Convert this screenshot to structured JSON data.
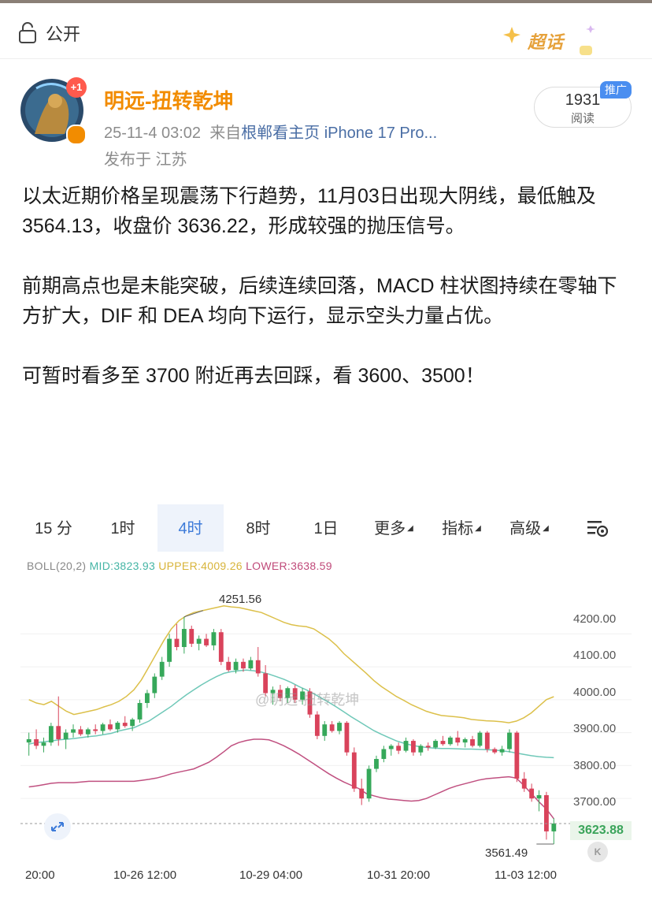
{
  "visibility": {
    "label": "公开",
    "icon": "lock-icon"
  },
  "topic_badge": {
    "label": "超话"
  },
  "author": {
    "name": "明远-扭转乾坤",
    "badge": "+1",
    "timestamp": "25-11-4 03:02",
    "source_prefix": "来自",
    "source": "根郸看主页 iPhone 17 Pro...",
    "location": "发布于 江苏"
  },
  "reads": {
    "count": "1931",
    "label": "阅读",
    "promo": "推广"
  },
  "post": {
    "para1": "以太近期价格呈现震荡下行趋势，11月03日出现大阴线，最低触及 3564.13，收盘价 3636.22，形成较强的抛压信号。",
    "para2": "前期高点也是未能突破，后续连续回落，MACD 柱状图持续在零轴下方扩大，DIF 和 DEA 均向下运行，显示空头力量占优。",
    "para3": "可暂时看多至 3700 附近再去回踩，看 3600、3500！"
  },
  "chart_tabs": [
    {
      "label": "15 分",
      "active": false
    },
    {
      "label": "1时",
      "active": false
    },
    {
      "label": "4时",
      "active": true
    },
    {
      "label": "8时",
      "active": false
    },
    {
      "label": "1日",
      "active": false
    },
    {
      "label": "更多",
      "active": false,
      "dropdown": true
    },
    {
      "label": "指标",
      "active": false,
      "dropdown": true
    },
    {
      "label": "高级",
      "active": false,
      "dropdown": true
    }
  ],
  "boll": {
    "name": "BOLL(20,2)",
    "mid": "MID:3823.93",
    "upper": "UPPER:4009.26",
    "lower": "LOWER:3638.59"
  },
  "chart_labels": {
    "max": "4251.56",
    "min": "3561.49",
    "last_price": "3623.88",
    "watermark": "@明远-扭转乾坤"
  },
  "chart_data": {
    "type": "candlestick",
    "y_ticks": [
      "4200.00",
      "4100.00",
      "4000.00",
      "3900.00",
      "3800.00",
      "3700.00"
    ],
    "x_ticks": [
      "20:00",
      "10-26 12:00",
      "10-29 04:00",
      "10-31 20:00",
      "11-03 12:00"
    ],
    "ylim": [
      3540,
      4330
    ],
    "up_color": "#36a85a",
    "down_color": "#d9435b",
    "candles": [
      [
        3870,
        3900,
        3830,
        3880
      ],
      [
        3880,
        3910,
        3850,
        3860
      ],
      [
        3860,
        3885,
        3840,
        3870
      ],
      [
        3870,
        3930,
        3860,
        3920
      ],
      [
        3920,
        4010,
        3860,
        3880
      ],
      [
        3880,
        3910,
        3850,
        3900
      ],
      [
        3900,
        3925,
        3885,
        3910
      ],
      [
        3910,
        3920,
        3890,
        3895
      ],
      [
        3895,
        3915,
        3885,
        3910
      ],
      [
        3910,
        3925,
        3895,
        3905
      ],
      [
        3905,
        3930,
        3895,
        3925
      ],
      [
        3925,
        3940,
        3905,
        3910
      ],
      [
        3910,
        3935,
        3900,
        3930
      ],
      [
        3930,
        3950,
        3915,
        3920
      ],
      [
        3920,
        3945,
        3905,
        3940
      ],
      [
        3940,
        4000,
        3930,
        3990
      ],
      [
        3990,
        4030,
        3975,
        4020
      ],
      [
        4020,
        4080,
        4005,
        4070
      ],
      [
        4070,
        4130,
        4060,
        4115
      ],
      [
        4115,
        4200,
        4100,
        4185
      ],
      [
        4185,
        4230,
        4150,
        4160
      ],
      [
        4160,
        4251.56,
        4140,
        4215
      ],
      [
        4215,
        4225,
        4160,
        4170
      ],
      [
        4170,
        4195,
        4150,
        4185
      ],
      [
        4185,
        4200,
        4160,
        4165
      ],
      [
        4165,
        4215,
        4150,
        4205
      ],
      [
        4205,
        4215,
        4105,
        4115
      ],
      [
        4115,
        4130,
        4085,
        4090
      ],
      [
        4090,
        4125,
        4080,
        4115
      ],
      [
        4115,
        4125,
        4085,
        4095
      ],
      [
        4095,
        4130,
        4090,
        4120
      ],
      [
        4120,
        4160,
        4070,
        4080
      ],
      [
        4080,
        4105,
        4010,
        4020
      ],
      [
        4020,
        4040,
        3985,
        4030
      ],
      [
        4030,
        4045,
        3995,
        4005
      ],
      [
        4005,
        4040,
        3990,
        4035
      ],
      [
        4035,
        4045,
        3990,
        4000
      ],
      [
        4000,
        4035,
        3985,
        4025
      ],
      [
        4025,
        4035,
        3945,
        3955
      ],
      [
        3955,
        3965,
        3880,
        3890
      ],
      [
        3890,
        3935,
        3875,
        3925
      ],
      [
        3925,
        3935,
        3900,
        3905
      ],
      [
        3905,
        3935,
        3895,
        3930
      ],
      [
        3930,
        3935,
        3830,
        3840
      ],
      [
        3840,
        3855,
        3720,
        3730
      ],
      [
        3730,
        3760,
        3680,
        3700
      ],
      [
        3700,
        3800,
        3690,
        3790
      ],
      [
        3790,
        3830,
        3780,
        3820
      ],
      [
        3820,
        3860,
        3810,
        3850
      ],
      [
        3850,
        3865,
        3830,
        3860
      ],
      [
        3860,
        3870,
        3835,
        3845
      ],
      [
        3845,
        3885,
        3840,
        3875
      ],
      [
        3875,
        3880,
        3830,
        3840
      ],
      [
        3840,
        3865,
        3830,
        3860
      ],
      [
        3860,
        3870,
        3845,
        3855
      ],
      [
        3855,
        3880,
        3850,
        3875
      ],
      [
        3875,
        3890,
        3860,
        3865
      ],
      [
        3865,
        3890,
        3860,
        3885
      ],
      [
        3885,
        3905,
        3860,
        3870
      ],
      [
        3870,
        3885,
        3855,
        3880
      ],
      [
        3880,
        3890,
        3855,
        3860
      ],
      [
        3860,
        3905,
        3855,
        3900
      ],
      [
        3900,
        3905,
        3840,
        3850
      ],
      [
        3850,
        3855,
        3835,
        3840
      ],
      [
        3840,
        3860,
        3830,
        3850
      ],
      [
        3850,
        3910,
        3840,
        3900
      ],
      [
        3900,
        3905,
        3750,
        3760
      ],
      [
        3760,
        3780,
        3720,
        3730
      ],
      [
        3730,
        3745,
        3690,
        3700
      ],
      [
        3700,
        3725,
        3661,
        3710
      ],
      [
        3710,
        3720,
        3575,
        3600
      ],
      [
        3600,
        3640,
        3561.49,
        3623.88
      ]
    ],
    "boll_upper": [
      4000,
      3990,
      3985,
      3995,
      3980,
      3965,
      3955,
      3960,
      3965,
      3970,
      3978,
      3985,
      3995,
      4010,
      4030,
      4060,
      4100,
      4140,
      4180,
      4215,
      4240,
      4255,
      4265,
      4270,
      4275,
      4280,
      4285,
      4282,
      4280,
      4275,
      4270,
      4265,
      4255,
      4245,
      4235,
      4228,
      4224,
      4222,
      4215,
      4200,
      4185,
      4165,
      4140,
      4120,
      4100,
      4080,
      4058,
      4040,
      4025,
      4010,
      3998,
      3985,
      3975,
      3965,
      3958,
      3952,
      3950,
      3948,
      3945,
      3940,
      3938,
      3936,
      3935,
      3933,
      3930,
      3935,
      3945,
      3960,
      3980,
      4000,
      4009.26
    ],
    "boll_mid": [
      3865,
      3870,
      3872,
      3875,
      3878,
      3880,
      3882,
      3885,
      3888,
      3890,
      3894,
      3898,
      3905,
      3910,
      3915,
      3925,
      3935,
      3950,
      3965,
      3980,
      3998,
      4015,
      4030,
      4045,
      4058,
      4070,
      4080,
      4085,
      4088,
      4090,
      4088,
      4084,
      4078,
      4070,
      4062,
      4052,
      4040,
      4030,
      4018,
      4005,
      3992,
      3978,
      3963,
      3948,
      3934,
      3920,
      3906,
      3895,
      3885,
      3875,
      3868,
      3862,
      3858,
      3855,
      3853,
      3852,
      3852,
      3851,
      3850,
      3850,
      3849,
      3848,
      3847,
      3845,
      3842,
      3838,
      3834,
      3830,
      3827,
      3825,
      3823.93
    ],
    "boll_lower": [
      3735,
      3738,
      3742,
      3746,
      3748,
      3748,
      3748,
      3750,
      3752,
      3752,
      3752,
      3752,
      3752,
      3752,
      3752,
      3755,
      3758,
      3762,
      3768,
      3775,
      3780,
      3785,
      3790,
      3800,
      3810,
      3825,
      3842,
      3860,
      3870,
      3876,
      3880,
      3880,
      3878,
      3870,
      3860,
      3848,
      3835,
      3820,
      3805,
      3790,
      3775,
      3762,
      3750,
      3740,
      3730,
      3715,
      3708,
      3702,
      3698,
      3696,
      3694,
      3692,
      3694,
      3700,
      3710,
      3720,
      3730,
      3738,
      3744,
      3750,
      3756,
      3760,
      3762,
      3764,
      3766,
      3762,
      3740,
      3715,
      3690,
      3668,
      3638.59
    ]
  }
}
